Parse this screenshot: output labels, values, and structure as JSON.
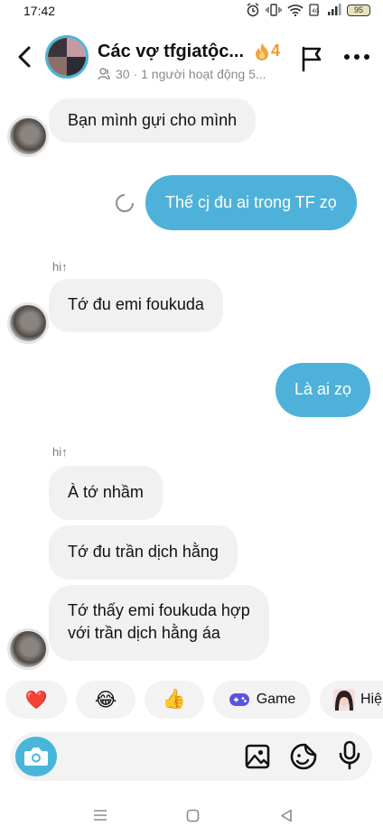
{
  "status_bar": {
    "time": "17:42",
    "battery": "95"
  },
  "header": {
    "group_name": "Các vợ tfgiatộc...",
    "streak_count": "4",
    "member_count": "30",
    "activity": "· 1 người hoạt động 5..."
  },
  "messages": [
    {
      "direction": "in",
      "text": "Bạn mình gựi cho mình"
    },
    {
      "direction": "out",
      "text": "Thế cj đu ai trong TF zọ",
      "status": "sending"
    },
    {
      "sender": "hi↑"
    },
    {
      "direction": "in",
      "text": "Tớ đu emi foukuda"
    },
    {
      "direction": "out",
      "text": "Là ai zọ"
    },
    {
      "sender": "hi↑"
    },
    {
      "direction": "in",
      "text": "À tớ nhầm"
    },
    {
      "direction": "in",
      "text": "Tớ đu trần dịch hằng"
    },
    {
      "direction": "in",
      "lines": [
        "Tớ thấy emi foukuda hợp",
        "với trần dịch hằng áa"
      ]
    }
  ],
  "quick_reactions": [
    {
      "icon": "heart-emoji",
      "glyph": "❤️"
    },
    {
      "icon": "laughing-emoji",
      "glyph": "😂"
    },
    {
      "icon": "thumbs-up-emoji",
      "glyph": "👍"
    },
    {
      "icon": "gamepad-icon",
      "label": "Game"
    },
    {
      "icon": "sticker-avatar",
      "label": "Hiệ"
    }
  ],
  "composer": {
    "icons": [
      "camera-icon",
      "image-icon",
      "sticker-icon",
      "microphone-icon"
    ]
  },
  "colors": {
    "accent": "#49b6d9",
    "outgoing_bubble": "#4eb1da",
    "incoming_bubble": "#f1f1f1",
    "streak": "#f0982f"
  }
}
